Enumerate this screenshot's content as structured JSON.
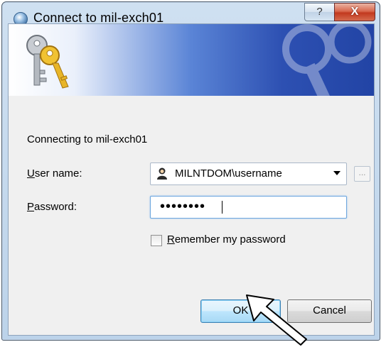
{
  "window": {
    "title": "Connect to mil-exch01",
    "help_label": "?",
    "close_label": "X"
  },
  "dialog": {
    "connecting_text": "Connecting to mil-exch01",
    "username_label_accel": "U",
    "username_label_rest": "ser name:",
    "username_value": "MILNTDOM\\username",
    "browse_label": "...",
    "password_label_accel": "P",
    "password_label_rest": "assword:",
    "password_mask": "••••••••",
    "remember_accel": "R",
    "remember_rest": "emember my password",
    "remember_checked": false,
    "ok_label": "OK",
    "cancel_label": "Cancel"
  },
  "icons": {
    "title": "globe-icon",
    "banner": "keys-icon",
    "user": "user-icon",
    "cursor": "mouse-pointer-icon"
  },
  "colors": {
    "banner_blue": "#2d50b2",
    "close_red": "#c2391f",
    "ok_focus": "#3c7fb1"
  }
}
